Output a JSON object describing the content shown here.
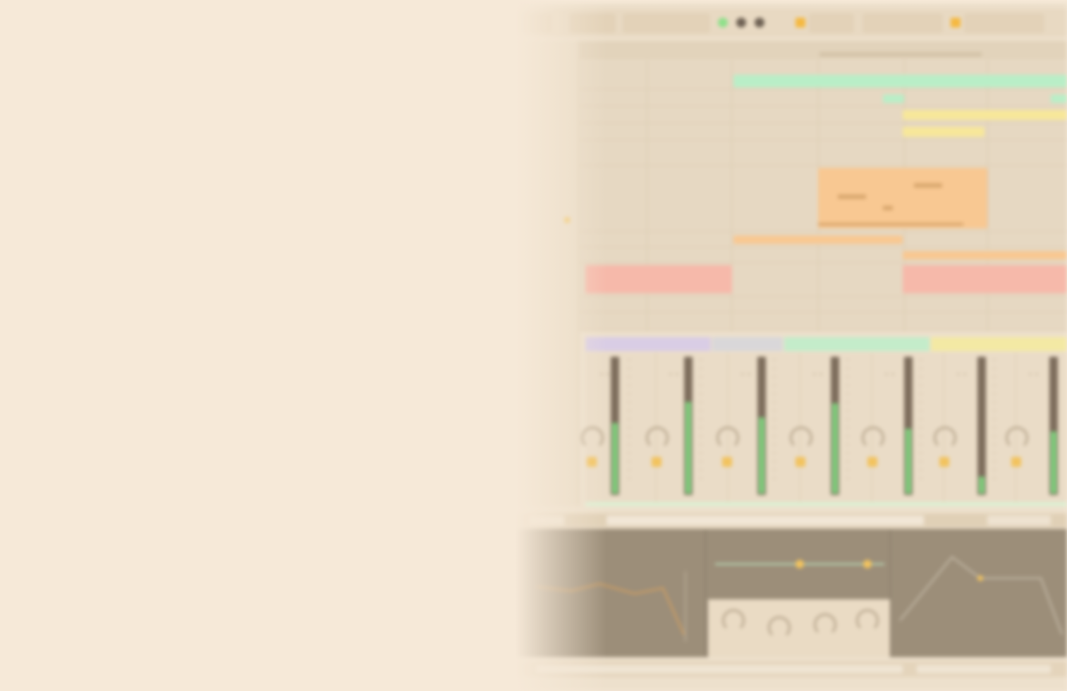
{
  "colors": {
    "background": "#f6e9d8",
    "app_base": "#ede0cc",
    "clip_green": "#b9eec7",
    "clip_yellow": "#f7e79a",
    "clip_orange": "#f8c892",
    "clip_red": "#f6b9aa",
    "clip_lavender": "#d8cce6",
    "meter_green": "#7fd07d",
    "accent_orange": "#f5b941",
    "device_panel": "#9c8e79"
  },
  "state": {
    "blur": "heavy — no legible text in the screenshot"
  },
  "icons": {
    "play": "play-icon",
    "stop": "stop-icon",
    "record": "record-icon",
    "knob": "pan-knob-icon"
  }
}
